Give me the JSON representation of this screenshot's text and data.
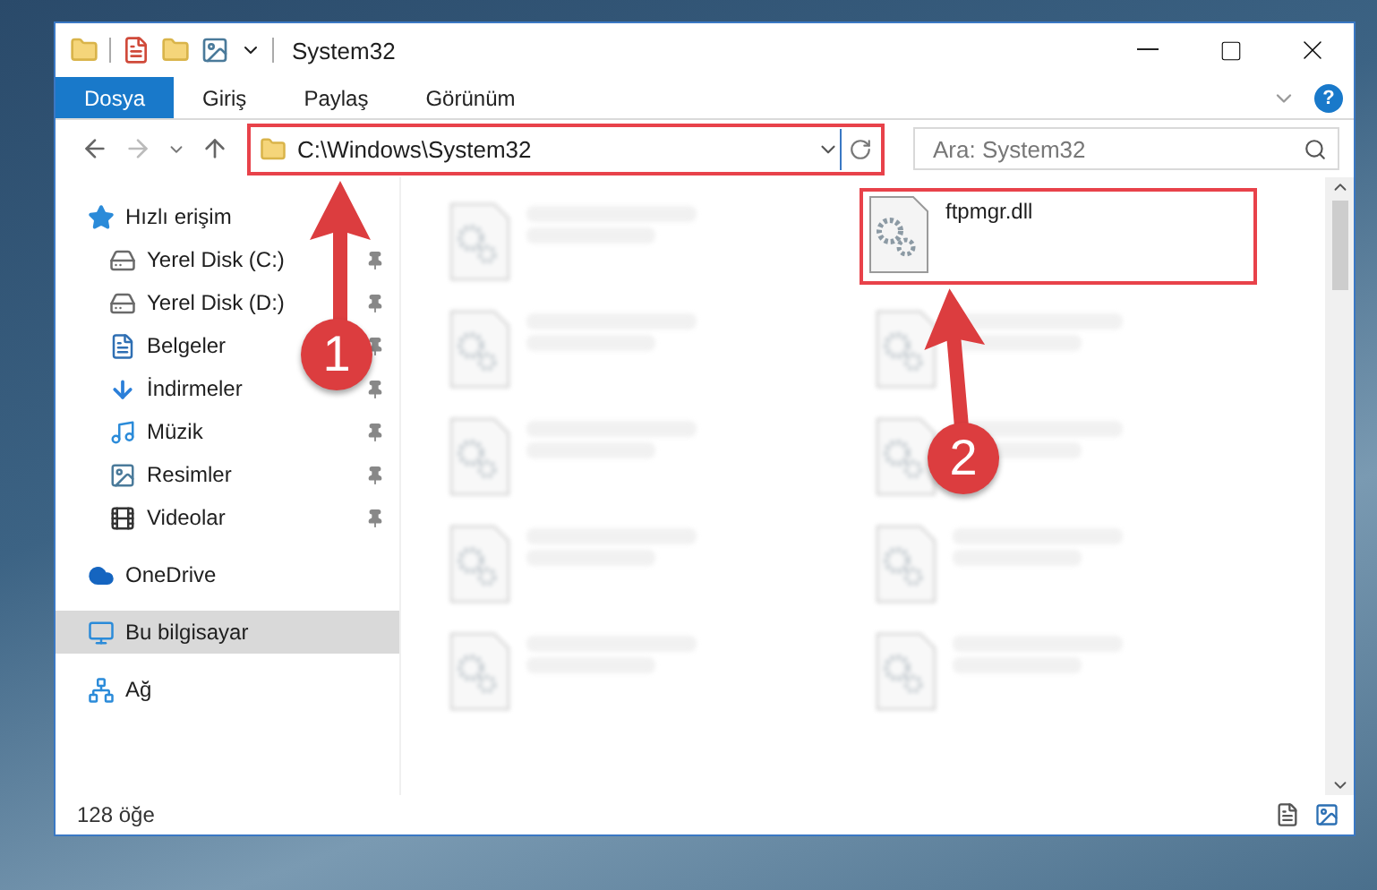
{
  "window": {
    "title": "System32"
  },
  "ribbon_tabs": [
    {
      "label": "Dosya",
      "selected": true
    },
    {
      "label": "Giriş",
      "selected": false
    },
    {
      "label": "Paylaş",
      "selected": false
    },
    {
      "label": "Görünüm",
      "selected": false
    }
  ],
  "help_button": "?",
  "address_bar": {
    "path": "C:\\Windows\\System32",
    "highlighted": true
  },
  "search": {
    "placeholder": "Ara: System32"
  },
  "sidebar": {
    "items": [
      {
        "label": "Hızlı erişim",
        "selected": false,
        "children": [
          {
            "label": "Yerel Disk (C:)",
            "pinned": true,
            "selected": false
          },
          {
            "label": "Yerel Disk (D:)",
            "pinned": true,
            "selected": false
          },
          {
            "label": "Belgeler",
            "pinned": true,
            "selected": false
          },
          {
            "label": "İndirmeler",
            "pinned": true,
            "selected": false
          },
          {
            "label": "Müzik",
            "pinned": true,
            "selected": false
          },
          {
            "label": "Resimler",
            "pinned": true,
            "selected": false
          },
          {
            "label": "Videolar",
            "pinned": true,
            "selected": false
          }
        ]
      },
      {
        "label": "OneDrive",
        "selected": false
      },
      {
        "label": "Bu bilgisayar",
        "selected": true
      },
      {
        "label": "Ağ",
        "selected": false
      }
    ]
  },
  "files": [
    {
      "blurred": true,
      "highlighted": false
    },
    {
      "name": "ftpmgr.dll",
      "blurred": false,
      "highlighted": true
    },
    {
      "blurred": true,
      "highlighted": false
    },
    {
      "blurred": true,
      "highlighted": false
    },
    {
      "blurred": true,
      "highlighted": false
    },
    {
      "blurred": true,
      "highlighted": false
    },
    {
      "blurred": true,
      "highlighted": false
    },
    {
      "blurred": true,
      "highlighted": false
    },
    {
      "blurred": true,
      "highlighted": false
    },
    {
      "blurred": true,
      "highlighted": false
    }
  ],
  "status_bar": {
    "item_count": "128 öğe"
  },
  "callouts": [
    {
      "number": "1"
    },
    {
      "number": "2"
    }
  ]
}
